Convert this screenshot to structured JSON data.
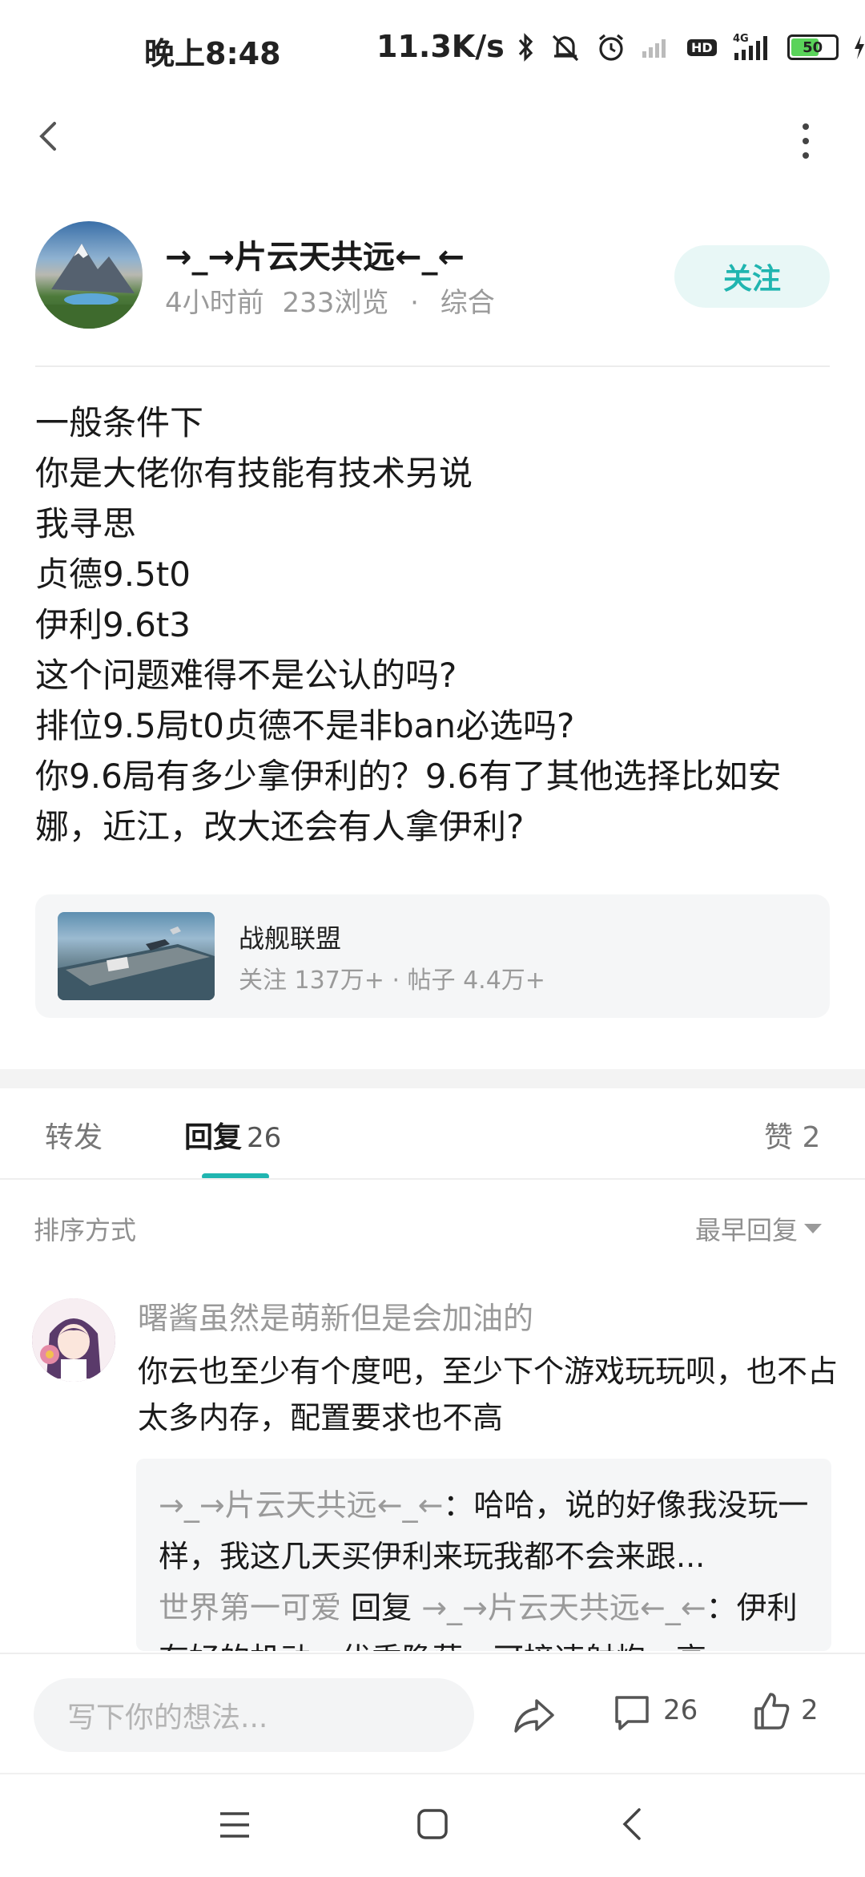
{
  "status_bar": {
    "time": "晚上8:48",
    "net_speed": "11.3K/s",
    "battery_level": "50",
    "hd_label": "HD",
    "network_type": "4G"
  },
  "post": {
    "author": "→_→片云天共远←_←",
    "time_ago": "4小时前",
    "views": "233浏览",
    "separator": "·",
    "category": "综合",
    "follow_label": "关注",
    "body_lines": [
      "一般条件下",
      "你是大佬你有技能有技术另说",
      "我寻思",
      "贞德9.5t0",
      "伊利9.6t3",
      "这个问题难得不是公认的吗?",
      "排位9.5局t0贞德不是非ban必选吗?",
      "你9.6局有多少拿伊利的？9.6有了其他选择比如安",
      "娜，近江，改大还会有人拿伊利?"
    ]
  },
  "forum": {
    "name": "战舰联盟",
    "stats": "关注 137万+ · 帖子 4.4万+"
  },
  "tabs": {
    "forward": "转发",
    "reply": "回复",
    "reply_count": "26",
    "like": "赞 2"
  },
  "sort": {
    "label": "排序方式",
    "value": "最早回复"
  },
  "comment": {
    "user": "曙酱虽然是萌新但是会加油的",
    "text": "你云也至少有个度吧，至少下个游戏玩玩呗，也不占太多内存，配置要求也不高",
    "replies": {
      "r1_user": "→_→片云天共远←_←",
      "r1_text": "：哈哈，说的好像我没玩一样，我这几天买伊利来玩我都不会来跟...",
      "r2_user": "世界第一可爱",
      "r2_reply_word": "回复",
      "r2_target": "→_→片云天共远←_←",
      "r2_text": "：伊利有好的机动，优秀隐蔽，可接速射炮，高..."
    }
  },
  "bottom_bar": {
    "input_placeholder": "写下你的想法...",
    "comment_count": "26",
    "like_count": "2"
  },
  "colors": {
    "accent": "#20b5b0",
    "follow_bg": "#e8f7f6",
    "muted_text": "#9a9a9a",
    "card_bg": "#f5f6f7"
  }
}
